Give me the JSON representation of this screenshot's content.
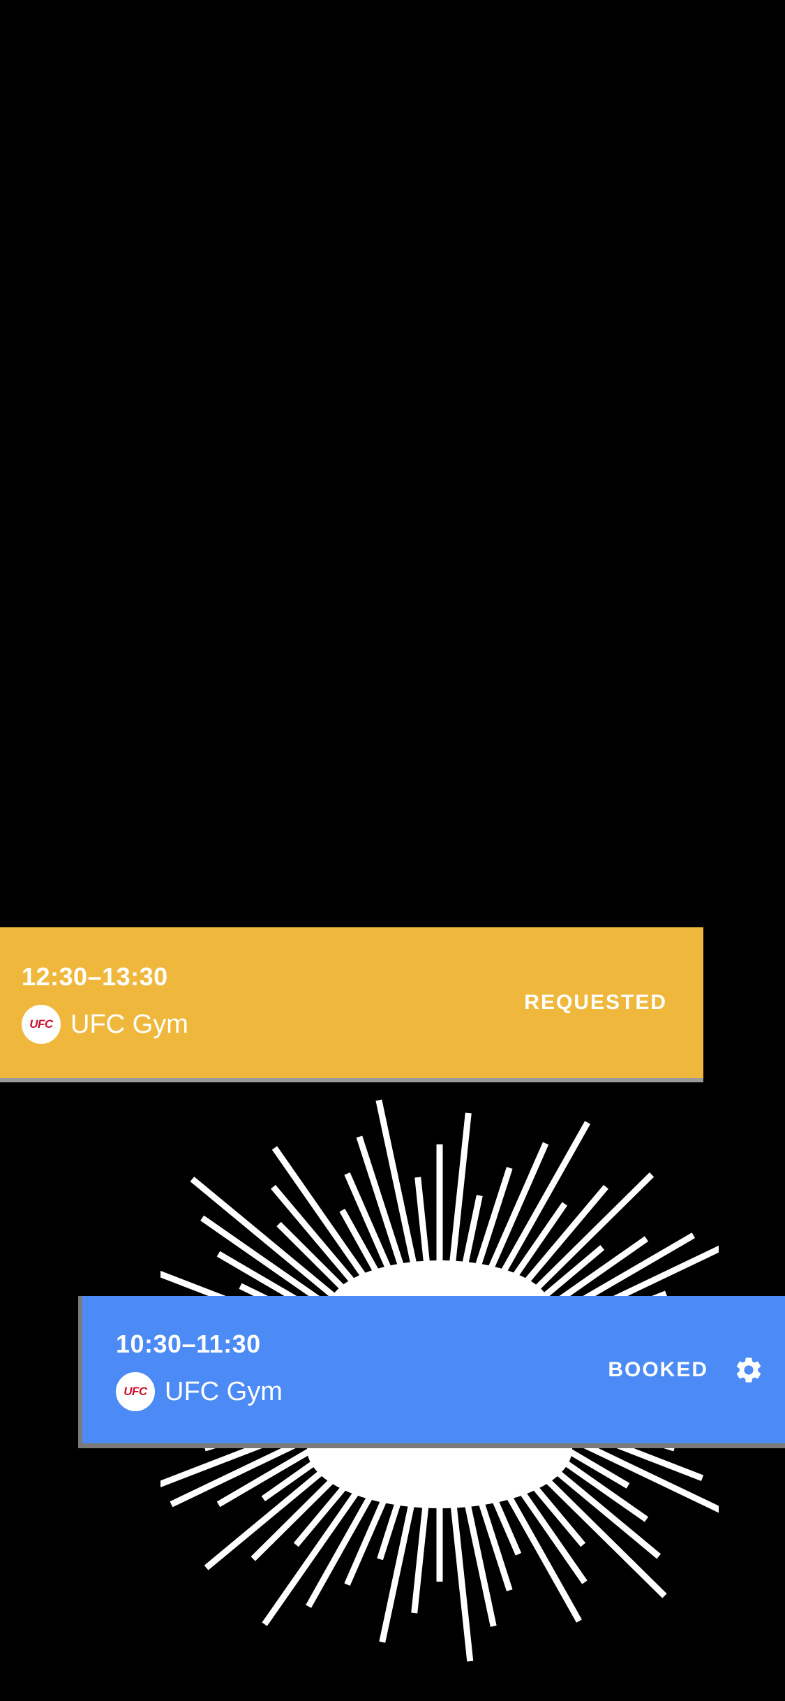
{
  "colors": {
    "background": "#000000",
    "requested_card": "#EFB83C",
    "booked_card": "#4C8BF5",
    "text": "#FFFFFF",
    "logo_red": "#C8102E"
  },
  "bookings": [
    {
      "time": "12:30–13:30",
      "logo_text": "UFC",
      "venue": "UFC Gym",
      "status": "REQUESTED"
    },
    {
      "time": "10:30–11:30",
      "logo_text": "UFC",
      "venue": "UFC Gym",
      "status": "BOOKED",
      "action_icon": "gear-icon"
    }
  ]
}
